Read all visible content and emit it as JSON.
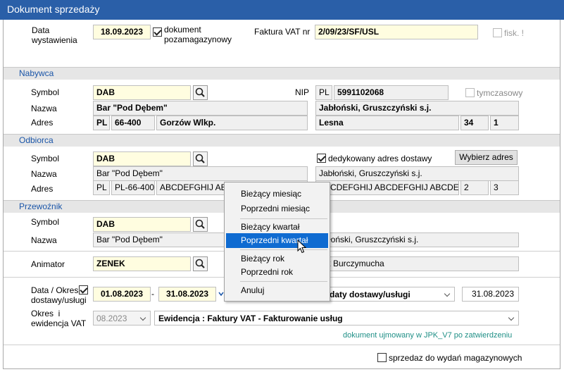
{
  "window": {
    "title": "Dokument sprzedaży"
  },
  "header": {
    "data_label": "Data\nwystawienia",
    "data_value": "18.09.2023",
    "pozamag_label": "dokument\npozamagazynowy",
    "faktura_label": "Faktura VAT nr",
    "faktura_value": "2/09/23/SF/USL",
    "fisk_label": "fisk. !"
  },
  "nabywca": {
    "section": "Nabywca",
    "symbol_label": "Symbol",
    "symbol": "DAB",
    "nazwa_label": "Nazwa",
    "nazwa": "Bar \"Pod Dębem\"",
    "adres_label": "Adres",
    "kraj": "PL",
    "kod": "66-400",
    "miasto": "Gorzów Wlkp.",
    "nip_label": "NIP",
    "nip_kraj": "PL",
    "nip": "5991102068",
    "tymczasowy": "tymczasowy",
    "nazwa2": "Jabłoński, Gruszczyński s.j.",
    "ulica": "Lesna",
    "nr": "34",
    "lok": "1"
  },
  "odbiorca": {
    "section": "Odbiorca",
    "symbol_label": "Symbol",
    "symbol": "DAB",
    "nazwa_label": "Nazwa",
    "nazwa": "Bar \"Pod Dębem\"",
    "adres_label": "Adres",
    "kraj": "PL",
    "kod": "PL-66-400",
    "miasto": "ABCDEFGHIJ ABCDEFGHIJ ABCDEFGHIJ",
    "dedykowany": "dedykowany adres dostawy",
    "wybierz": "Wybierz adres",
    "nazwa2": "Jabłoński, Gruszczyński s.j.",
    "ulica": "ABCDEFGHIJ ABCDEFGHIJ ABCDEFGHIJ",
    "nr": "2",
    "lok": "3"
  },
  "przewoznik": {
    "section": "Przewoźnik",
    "symbol_label": "Symbol",
    "symbol": "DAB",
    "nazwa_label": "Nazwa",
    "nazwa": "Bar \"Pod Dębem\"",
    "nazwa2": "łoński, Gruszczyński s.j."
  },
  "animator": {
    "label": "Animator",
    "value": "ZENEK",
    "name": "ek Burczymucha"
  },
  "okres": {
    "label": "Data / Okres\ndostawy/usługi",
    "od": "01.08.2023",
    "do": "31.08.2023",
    "typ": "daty dostawy/usługi",
    "data": "31.08.2023",
    "okres_label": "Okres  i\newidencja VAT",
    "miesiac": "08.2023",
    "ewidencja": "Ewidencja : Faktury VAT - Fakturowanie usług",
    "info": "dokument ujmowany w JPK_V7 po zatwierdzeniu"
  },
  "footer": {
    "sprzedaz": "sprzedaz do wydań magazynowych"
  },
  "menu": {
    "items": [
      "Bieżący miesiąc",
      "Poprzedni miesiąc",
      "Bieżący kwartał",
      "Poprzedni kwartał",
      "Bieżący rok",
      "Poprzedni rok",
      "Anuluj"
    ],
    "highlighted": "Poprzedni kwartał"
  },
  "colors": {
    "title_bar": "#2a5fa8",
    "section_text": "#1a55a8",
    "highlight": "#0f6bd1",
    "info_text": "#1f8f86"
  }
}
